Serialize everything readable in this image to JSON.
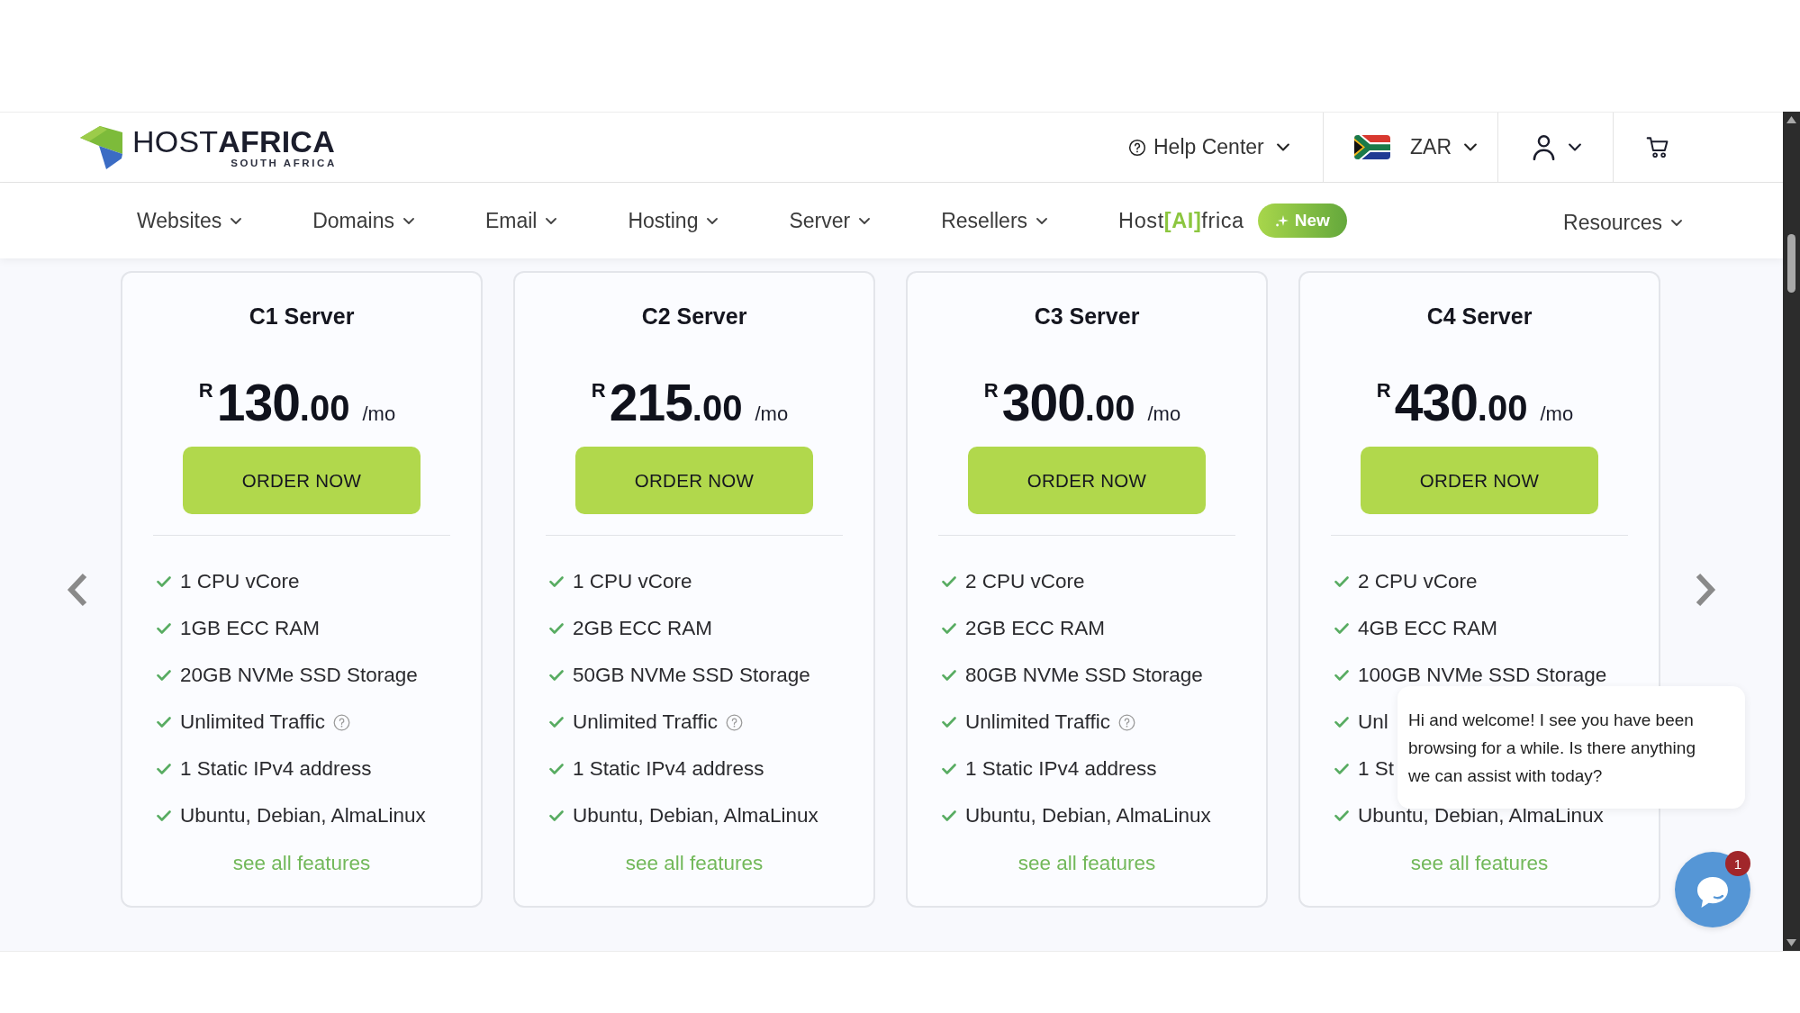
{
  "header": {
    "logo": {
      "name": "HOST**AFRICA**",
      "tagline": "SOUTH AFRICA"
    },
    "help_center": {
      "label": "Help Center"
    },
    "currency": {
      "code": "ZAR"
    }
  },
  "nav": {
    "items": [
      {
        "label": "Websites"
      },
      {
        "label": "Domains"
      },
      {
        "label": "Email"
      },
      {
        "label": "Hosting"
      },
      {
        "label": "Server"
      },
      {
        "label": "Resellers"
      }
    ],
    "ai_link": {
      "label": "Host**[AI]**frica",
      "badge": "New"
    },
    "resources": {
      "label": "Resources"
    }
  },
  "plans": [
    {
      "name": "C1 Server",
      "price": {
        "currency": "R",
        "amount": "130",
        "cents": ".00"
      },
      "period": "/mo",
      "button": "ORDER NOW",
      "features": [
        {
          "text": "1 CPU vCore",
          "info": false
        },
        {
          "text": "1GB ECC RAM",
          "info": false
        },
        {
          "text": "20GB NVMe SSD Storage",
          "info": false
        },
        {
          "text": "Unlimited Traffic",
          "info": true
        },
        {
          "text": "1 Static IPv4 address",
          "info": false
        },
        {
          "text": "Ubuntu, Debian, AlmaLinux",
          "info": false
        }
      ],
      "link": "see all features"
    },
    {
      "name": "C2 Server",
      "price": {
        "currency": "R",
        "amount": "215",
        "cents": ".00"
      },
      "period": "/mo",
      "button": "ORDER NOW",
      "features": [
        {
          "text": "1 CPU vCore",
          "info": false
        },
        {
          "text": "2GB ECC RAM",
          "info": false
        },
        {
          "text": "50GB NVMe SSD Storage",
          "info": false
        },
        {
          "text": "Unlimited Traffic",
          "info": true
        },
        {
          "text": "1 Static IPv4 address",
          "info": false
        },
        {
          "text": "Ubuntu, Debian, AlmaLinux",
          "info": false
        }
      ],
      "link": "see all features"
    },
    {
      "name": "C3 Server",
      "price": {
        "currency": "R",
        "amount": "300",
        "cents": ".00"
      },
      "period": "/mo",
      "button": "ORDER NOW",
      "features": [
        {
          "text": "2 CPU vCore",
          "info": false
        },
        {
          "text": "2GB ECC RAM",
          "info": false
        },
        {
          "text": "80GB NVMe SSD Storage",
          "info": false
        },
        {
          "text": "Unlimited Traffic",
          "info": true
        },
        {
          "text": "1 Static IPv4 address",
          "info": false
        },
        {
          "text": "Ubuntu, Debian, AlmaLinux",
          "info": false
        }
      ],
      "link": "see all features"
    },
    {
      "name": "C4 Server",
      "price": {
        "currency": "R",
        "amount": "430",
        "cents": ".00"
      },
      "period": "/mo",
      "button": "ORDER NOW",
      "features": [
        {
          "text": "2 CPU vCore",
          "info": false
        },
        {
          "text": "4GB ECC RAM",
          "info": false
        },
        {
          "text": "100GB NVMe SSD Storage",
          "info": false
        },
        {
          "text": "Unl",
          "info": false
        },
        {
          "text": "1 St",
          "info": false
        },
        {
          "text": "Ubuntu, Debian, AlmaLinux",
          "info": false
        }
      ],
      "link": "see all features"
    }
  ],
  "chat": {
    "message": "Hi and welcome! I see you have been browsing for a while. Is there anything we can assist with today?",
    "unread": "1"
  }
}
